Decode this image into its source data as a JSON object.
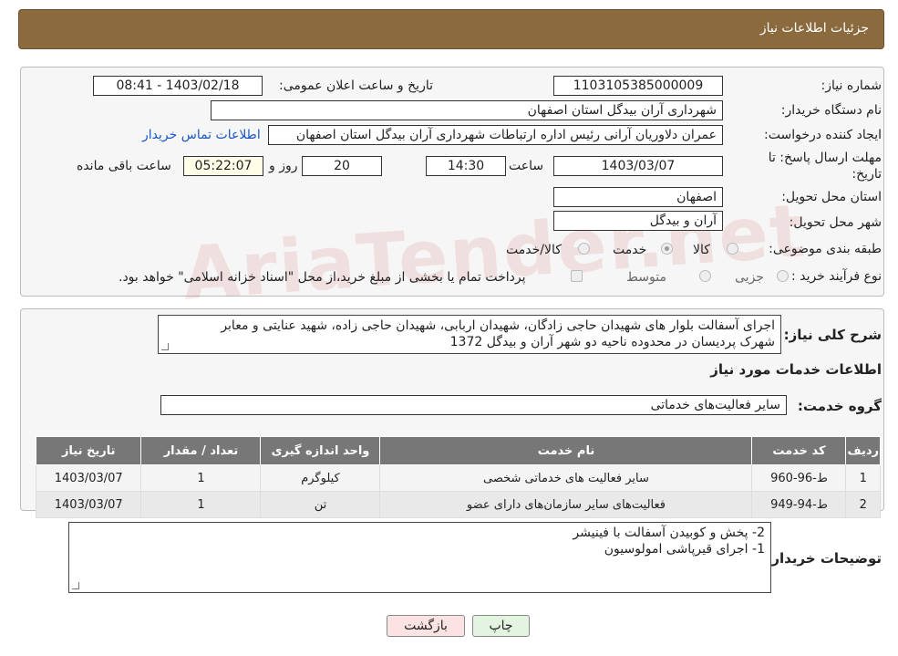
{
  "header": {
    "title": "جزئیات اطلاعات نیاز"
  },
  "need_number": {
    "label": "شماره نیاز:",
    "value": "1103105385000009"
  },
  "announce": {
    "label": "تاریخ و ساعت اعلان عمومی:",
    "value": "1403/02/18 - 08:41"
  },
  "buyer": {
    "label": "نام دستگاه خریدار:",
    "value": "شهرداری آران بیدگل استان اصفهان"
  },
  "creator": {
    "label": "ایجاد کننده درخواست:",
    "value": "عمران دلاوریان آرانی رئیس اداره ارتباطات شهرداری آران بیدگل استان اصفهان",
    "contact_link": "اطلاعات تماس خریدار"
  },
  "deadline": {
    "label": "مهلت ارسال پاسخ: تا تاریخ:",
    "date": "1403/03/07",
    "time_label": "ساعت",
    "time": "14:30",
    "days": "20",
    "days_label": "روز و",
    "remaining": "05:22:07",
    "remaining_label": "ساعت باقی مانده"
  },
  "province": {
    "label": "استان محل تحویل:",
    "value": "اصفهان"
  },
  "city": {
    "label": "شهر محل تحویل:",
    "value": "آران و بیدگل"
  },
  "category": {
    "label": "طبقه بندی موضوعی:",
    "options": [
      "کالا",
      "خدمت",
      "کالا/خدمت"
    ],
    "selected": "خدمت"
  },
  "purchase": {
    "label": "نوع فرآیند خرید :",
    "options": [
      "جزیی",
      "متوسط"
    ],
    "note": "پرداخت تمام یا بخشی از مبلغ خرید،از محل \"اسناد خزانه اسلامی\" خواهد بود."
  },
  "description": {
    "label": "شرح کلی نیاز:",
    "line1": "اجرای آسفالت بلوار های شهیدان حاجی زادگان، شهیدان اربابی، شهیدان حاجی زاده، شهید عنایتی و معابر",
    "line2": "شهرک پردیسان در محدوده ناحیه دو شهر آران و بیدگل 1372"
  },
  "services_title": "اطلاعات خدمات مورد نیاز",
  "service_group": {
    "label": "گروه خدمت:",
    "value": "سایر فعالیت‌های خدماتی"
  },
  "table": {
    "headers": [
      "ردیف",
      "کد خدمت",
      "نام خدمت",
      "واحد اندازه گیری",
      "تعداد / مقدار",
      "تاریخ نیاز"
    ],
    "rows": [
      [
        "1",
        "ط-96-960",
        "سایر فعالیت های خدماتی شخصی",
        "کیلوگرم",
        "1",
        "1403/03/07"
      ],
      [
        "2",
        "ط-94-949",
        "فعالیت‌های سایر سازمان‌های دارای عضو",
        "تن",
        "1",
        "1403/03/07"
      ]
    ]
  },
  "buyer_notes": {
    "label": "توضیحات خریدار:",
    "line1": "2- پخش و کوبیدن آسفالت با فینیشر",
    "line2": "1- اجرای قیرپاشی امولوسیون"
  },
  "buttons": {
    "print": "چاپ",
    "back": "بازگشت"
  },
  "watermark": "AriaTender.net",
  "colors": {
    "header_bg": "#8b6a3e",
    "link": "#1a56c4",
    "back_button_bg": "#fbe3e3",
    "print_button_bg": "#e3f5e0"
  }
}
